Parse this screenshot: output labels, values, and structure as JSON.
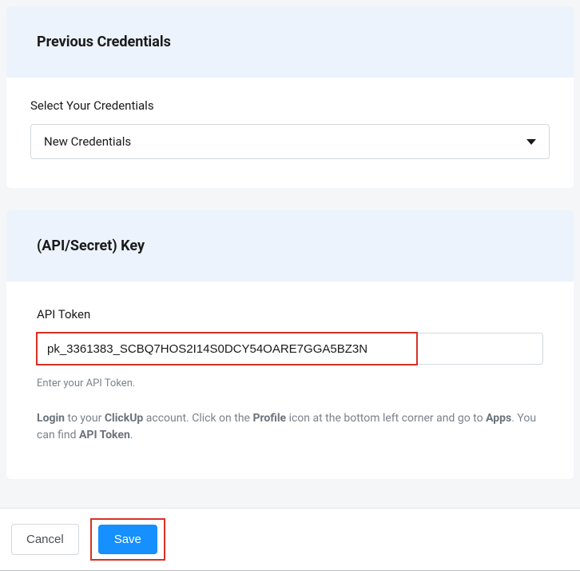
{
  "previous_credentials": {
    "title": "Previous Credentials",
    "select_label": "Select Your Credentials",
    "select_value": "New Credentials"
  },
  "api_section": {
    "title": "(API/Secret) Key",
    "token_label": "API Token",
    "token_value": "pk_3361383_SCBQ7HOS2I14S0DCY54OARE7GGA5BZ3N",
    "helper": "Enter your API Token.",
    "instruction": {
      "p1": "Login",
      "p2": " to your ",
      "p3": "ClickUp",
      "p4": " account. Click on the ",
      "p5": "Profile",
      "p6": " icon at the bottom left corner and go to ",
      "p7": "Apps",
      "p8": ". You can find ",
      "p9": "API Token",
      "p10": "."
    }
  },
  "footer": {
    "cancel": "Cancel",
    "save": "Save"
  }
}
